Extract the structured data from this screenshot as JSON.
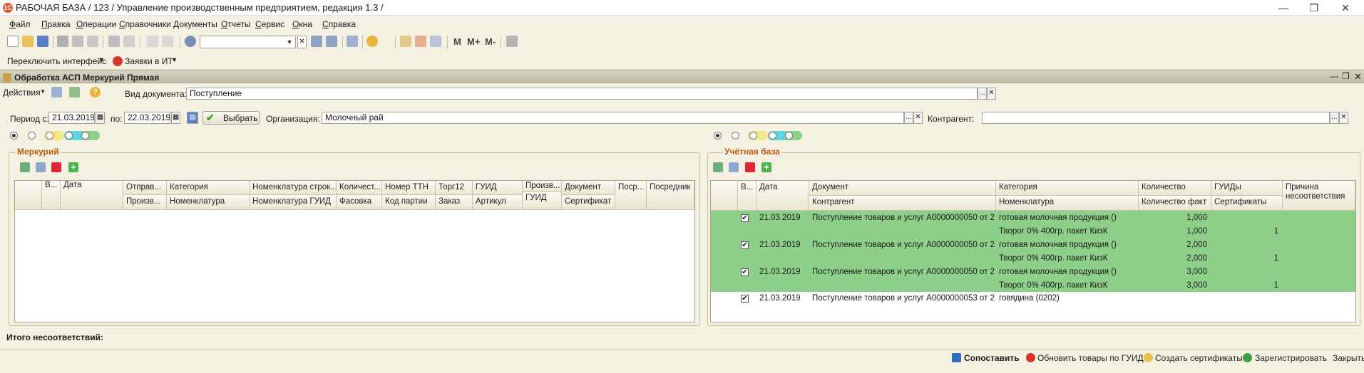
{
  "window": {
    "title": "РАБОЧАЯ БАЗА / 123 /  Управление производственным предприятием, редакция 1.3 /",
    "btn_min": "—",
    "btn_restore": "❐",
    "btn_close": "✕"
  },
  "menu": [
    "Файл",
    "Правка",
    "Операции",
    "Справочники",
    "Документы",
    "Отчеты",
    "Сервис",
    "Окна",
    "Справка"
  ],
  "toolbar": {
    "btn_m": "M",
    "btn_mplus": "M+",
    "btn_mminus": "M-"
  },
  "toolbar2": {
    "switch_interface": "Переключить интерфейс",
    "it_requests": "Заявки в ИТ"
  },
  "form": {
    "title": "Обработка  АСП Меркурий Прямая",
    "actions": "Действия",
    "doc_type_label": "Вид документа:",
    "doc_type_value": "Поступление",
    "period_from_label": "Период с:",
    "period_from": "21.03.2019",
    "period_to_label": "по:",
    "period_to": "22.03.2019",
    "select_btn": "Выбрать",
    "org_label": "Организация:",
    "org_value": "Молочный рай",
    "counterparty_label": "Контрагент:",
    "counterparty_value": "",
    "ellipsis": "...",
    "clear": "✕"
  },
  "mercury": {
    "title": "Меркурий",
    "headers_top": [
      "В...",
      "Дата",
      "Отправ...",
      "Категория",
      "Номенклатура строк...",
      "Количест...",
      "Номер ТТН",
      "Торг12",
      "ГУИД",
      "Произв...",
      "Документ",
      "Поср...",
      "Посредник"
    ],
    "headers_bottom": [
      "Произв...",
      "Номенклатура",
      "Номенклатура ГУИД",
      "Фасовка",
      "Код партии",
      "Заказ",
      "Артикул",
      "ГУИД",
      "Сертификат"
    ]
  },
  "account": {
    "title": "Учётная база",
    "headers_top": [
      "В...",
      "Дата",
      "Документ",
      "Категория",
      "Количество",
      "ГУИДы",
      "Причина несоответствия"
    ],
    "headers_bottom": [
      "Контрагент",
      "Номенклатура",
      "Количество факт",
      "Сертификаты"
    ],
    "rows": [
      {
        "checked": "✔",
        "date": "21.03.2019",
        "doc": "Поступление товаров и услуг А0000000050 от 2...",
        "category": "готовая молочная продукция ()",
        "qty": "1,000",
        "nomen": "Творог 0% 400гр. пакет КизК",
        "qty_fact": "1,000",
        "certs": "1"
      },
      {
        "checked": "✔",
        "date": "21.03.2019",
        "doc": "Поступление товаров и услуг А0000000050 от 2...",
        "category": "готовая молочная продукция ()",
        "qty": "2,000",
        "nomen": "Творог 0% 400гр. пакет КизК",
        "qty_fact": "2,000",
        "certs": "1"
      },
      {
        "checked": "✔",
        "date": "21.03.2019",
        "doc": "Поступление товаров и услуг А0000000050 от 2...",
        "category": "готовая молочная продукция ()",
        "qty": "3,000",
        "nomen": "Творог 0% 400гр. пакет КизК",
        "qty_fact": "3,000",
        "certs": "1"
      },
      {
        "checked": "✔",
        "date": "21.03.2019",
        "doc": "Поступление товаров и услуг А0000000053 от 2...",
        "category": "говядина (0202)",
        "qty": "",
        "nomen": "",
        "qty_fact": "",
        "certs": ""
      }
    ]
  },
  "total_mismatch_label": "Итого несоответствий:",
  "bottom": {
    "compare": "Сопоставить",
    "update_guid": "Обновить товары по ГУИД",
    "create_certs": "Создать сертификаты",
    "register": "Зарегистрировать",
    "close": "Закрыть"
  },
  "colors": {
    "accent_orange": "#c1590a",
    "row_green": "#8ecf8a",
    "bg": "#f4f1e3"
  }
}
